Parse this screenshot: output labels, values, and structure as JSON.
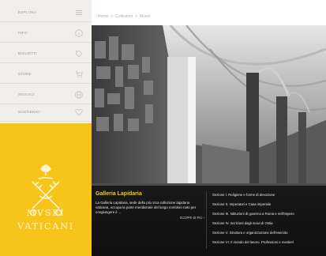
{
  "sidebar": {
    "nav": [
      {
        "label": "ESPLORA",
        "icon": "menu-icon"
      },
      {
        "label": "INFO",
        "icon": "info-icon"
      },
      {
        "label": "BIGLIETTI",
        "icon": "ticket-icon"
      },
      {
        "label": "STORE",
        "icon": "cart-icon"
      },
      {
        "label": "SEGUICI",
        "icon": "globe-icon"
      },
      {
        "label": "SOSTIENICI",
        "icon": "heart-icon"
      }
    ],
    "brand": {
      "line1": "MVSEI",
      "line2": "VATICANI"
    }
  },
  "breadcrumb": [
    "Home",
    ">",
    "Collezioni",
    ">",
    "Musei"
  ],
  "hero": {
    "title": "Galleria Lapidaria",
    "description": "La Galleria Lapidaria, sede della più ricca collezione lapidaria vaticana, occupa la parte meridionale del lungo corridoio nato per congiungere il ...",
    "more_label": "SCOPRI DI PIÙ ›",
    "sections": [
      "Sezione I. Religione e forme di devozione",
      "Sezione II. Imperatori e Casa imperiale",
      "Sezione III. Istituzioni di governo a Roma e nell'Impero",
      "Sezione IV. Iscrizioni dagli scavi di Ostia",
      "Sezione V. Struttura e organizzazione dell'esercito",
      "Sezione VI. Il mondo del lavoro. Professioni e mestieri"
    ]
  },
  "colors": {
    "accent": "#f7c51a",
    "sidebar_bg": "#f1efe9",
    "overlay": "#0c0c0c"
  }
}
